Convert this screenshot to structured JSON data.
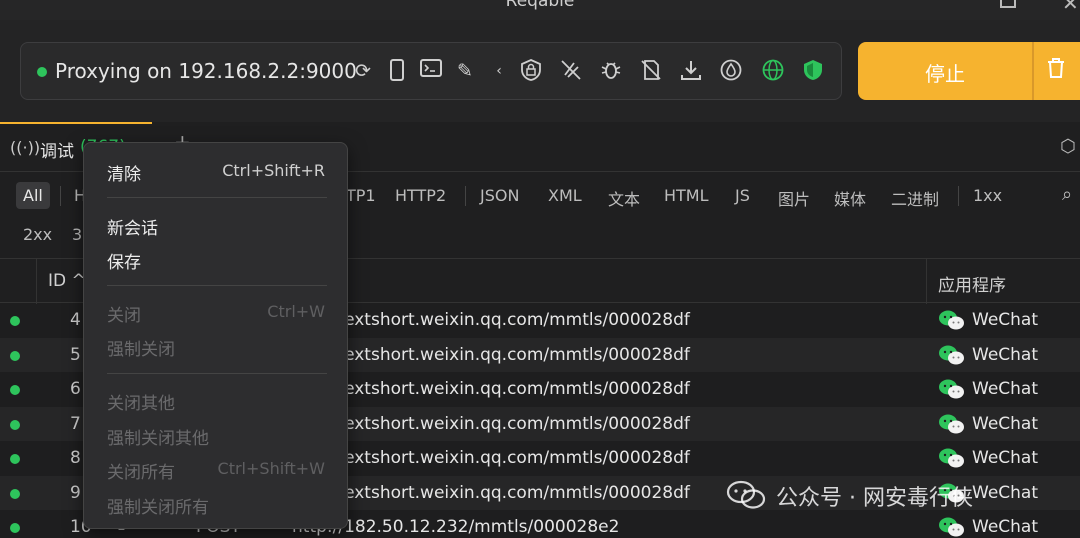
{
  "window": {
    "title": "Reqable"
  },
  "toolbar": {
    "proxy_status": "Proxying on 192.168.2.2:9000",
    "icons": [
      "refresh-icon",
      "phone-icon",
      "terminal-icon",
      "pencil-icon",
      "chevron-left-icon",
      "lock-shield-icon",
      "no-cast-icon",
      "bug-icon",
      "no-file-icon",
      "download-icon",
      "drop-icon",
      "globe-icon",
      "shield-check-icon"
    ],
    "stop_label": "停止"
  },
  "tabs": {
    "debug_label": "调试",
    "debug_count": "(767)"
  },
  "filters": {
    "row1": [
      "All",
      "H",
      "TP1",
      "HTTP2",
      "JSON",
      "XML",
      "文本",
      "HTML",
      "JS",
      "图片",
      "媒体",
      "二进制",
      "1xx"
    ],
    "row2": [
      "2xx",
      "3"
    ]
  },
  "table": {
    "headers": {
      "id": "ID",
      "app": "应用程序"
    },
    "rows": [
      {
        "id": "4",
        "method": "",
        "url": "http://extshort.weixin.qq.com/mmtls/000028df",
        "app": "WeChat"
      },
      {
        "id": "5",
        "method": "",
        "url": "http://extshort.weixin.qq.com/mmtls/000028df",
        "app": "WeChat"
      },
      {
        "id": "6",
        "method": "",
        "url": "http://extshort.weixin.qq.com/mmtls/000028df",
        "app": "WeChat"
      },
      {
        "id": "7",
        "method": "",
        "url": "http://extshort.weixin.qq.com/mmtls/000028df",
        "app": "WeChat"
      },
      {
        "id": "8",
        "method": "",
        "url": "http://extshort.weixin.qq.com/mmtls/000028df",
        "app": "WeChat"
      },
      {
        "id": "9",
        "method": "",
        "url": "http://extshort.weixin.qq.com/mmtls/000028df",
        "app": "WeChat"
      },
      {
        "id": "10",
        "method": "POST",
        "url": "http://182.50.12.232/mmtls/000028e2",
        "app": "WeChat"
      }
    ]
  },
  "context_menu": {
    "clear": {
      "label": "清除",
      "shortcut": "Ctrl+Shift+R"
    },
    "new_session": "新会话",
    "save": "保存",
    "close": {
      "label": "关闭",
      "shortcut": "Ctrl+W"
    },
    "force_close": "强制关闭",
    "close_others": "关闭其他",
    "force_close_others": "强制关闭其他",
    "close_all": {
      "label": "关闭所有",
      "shortcut": "Ctrl+Shift+W"
    },
    "force_close_all": "强制关闭所有"
  },
  "watermark": {
    "text": "公众号 · 网安毒行侠"
  },
  "colors": {
    "accent": "#f6b32f",
    "status_green": "#2ec45c",
    "background": "#1e1e1f"
  }
}
